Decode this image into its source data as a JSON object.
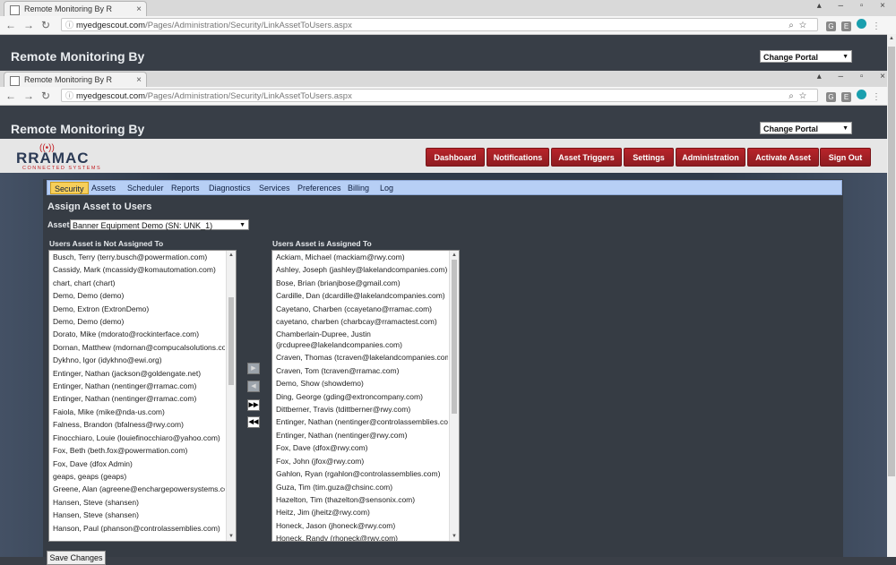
{
  "browser": {
    "tab_title": "Remote Monitoring By R",
    "url_host": "myedgescout.com",
    "url_path": "/Pages/Administration/Security/LinkAssetToUsers.aspx",
    "ext_badges": [
      "G",
      "E"
    ]
  },
  "header": {
    "app_title": "Remote Monitoring By",
    "portal_select": "Change Portal"
  },
  "logo": {
    "name": "RRAMAC",
    "tagline": "CONNECTED SYSTEMS"
  },
  "topnav": [
    "Dashboard",
    "Notifications",
    "Asset Triggers",
    "Settings",
    "Administration",
    "Activate Asset",
    "Sign Out"
  ],
  "subnav": {
    "items": [
      "Security",
      "Assets",
      "Scheduler",
      "Reports",
      "Diagnostics",
      "Services",
      "Preferences",
      "Billing",
      "Log"
    ],
    "active": "Security"
  },
  "main": {
    "title": "Assign Asset to Users",
    "asset_label": "Asset:",
    "asset_value": "Banner Equipment Demo (SN: UNK_1)",
    "not_assigned_title": "Users Asset is Not Assigned To",
    "assigned_title": "Users Asset is Assigned To",
    "save_label": "Save Changes",
    "not_assigned": [
      "Busch, Terry (terry.busch@powermation.com)",
      "Cassidy, Mark (mcassidy@komautomation.com)",
      "chart, chart (chart)",
      "Demo, Demo (demo)",
      "Demo, Extron (ExtronDemo)",
      "Demo, Demo (demo)",
      "Dorato, Mike (mdorato@rockinterface.com)",
      "Dornan, Matthew (mdornan@compucalsolutions.com)",
      "Dykhno, Igor (idykhno@ewi.org)",
      "Entinger, Nathan (jackson@goldengate.net)",
      "Entinger, Nathan (nentinger@rramac.com)",
      "Entinger, Nathan (nentinger@rramac.com)",
      "Faiola, Mike (mike@nda-us.com)",
      "Falness, Brandon (bfalness@rwy.com)",
      "Finocchiaro, Louie (louiefinocchiaro@yahoo.com)",
      "Fox, Beth (beth.fox@powermation.com)",
      "Fox, Dave (dfox Admin)",
      "geaps, geaps (geaps)",
      "Greene, Alan (agreene@enchargepowersystems.com)",
      "Hansen, Steve (shansen)",
      "Hansen, Steve (shansen)",
      "Hanson, Paul (phanson@controlassemblies.com)"
    ],
    "assigned": [
      "Ackiam, Michael (mackiam@rwy.com)",
      "Ashley, Joseph (jashley@lakelandcompanies.com)",
      "Bose, Brian (brianjbose@gmail.com)",
      "Cardille, Dan (dcardille@lakelandcompanies.com)",
      "Cayetano, Charben (ccayetano@rramac.com)",
      "cayetano, charben (charbcay@rramactest.com)",
      "Chamberlain-Dupree, Justin (jrcdupree@lakelandcompanies.com)",
      "Craven, Thomas (tcraven@lakelandcompanies.com)",
      "Craven, Tom (tcraven@rramac.com)",
      "Demo, Show (showdemo)",
      "Ding, George (gding@extroncompany.com)",
      "Dittberner, Travis (tdittberner@rwy.com)",
      "Entinger, Nathan (nentinger@controlassemblies.com)",
      "Entinger, Nathan (nentinger@rwy.com)",
      "Fox, Dave (dfox@rwy.com)",
      "Fox, John (jfox@rwy.com)",
      "Gahlon, Ryan (rgahlon@controlassemblies.com)",
      "Guza, Tim (tim.guza@chsinc.com)",
      "Hazelton, Tim (thazelton@sensonix.com)",
      "Heitz, Jim (jheitz@rwy.com)",
      "Honeck, Jason (jhoneck@rwy.com)",
      "Honeck, Randy (rhoneck@rwy.com)"
    ]
  },
  "colors": {
    "nav_red": "#a3202a",
    "subnav_blue": "#b7cff5",
    "active_tab": "#f7cf5a",
    "header_bg": "#383e47"
  }
}
